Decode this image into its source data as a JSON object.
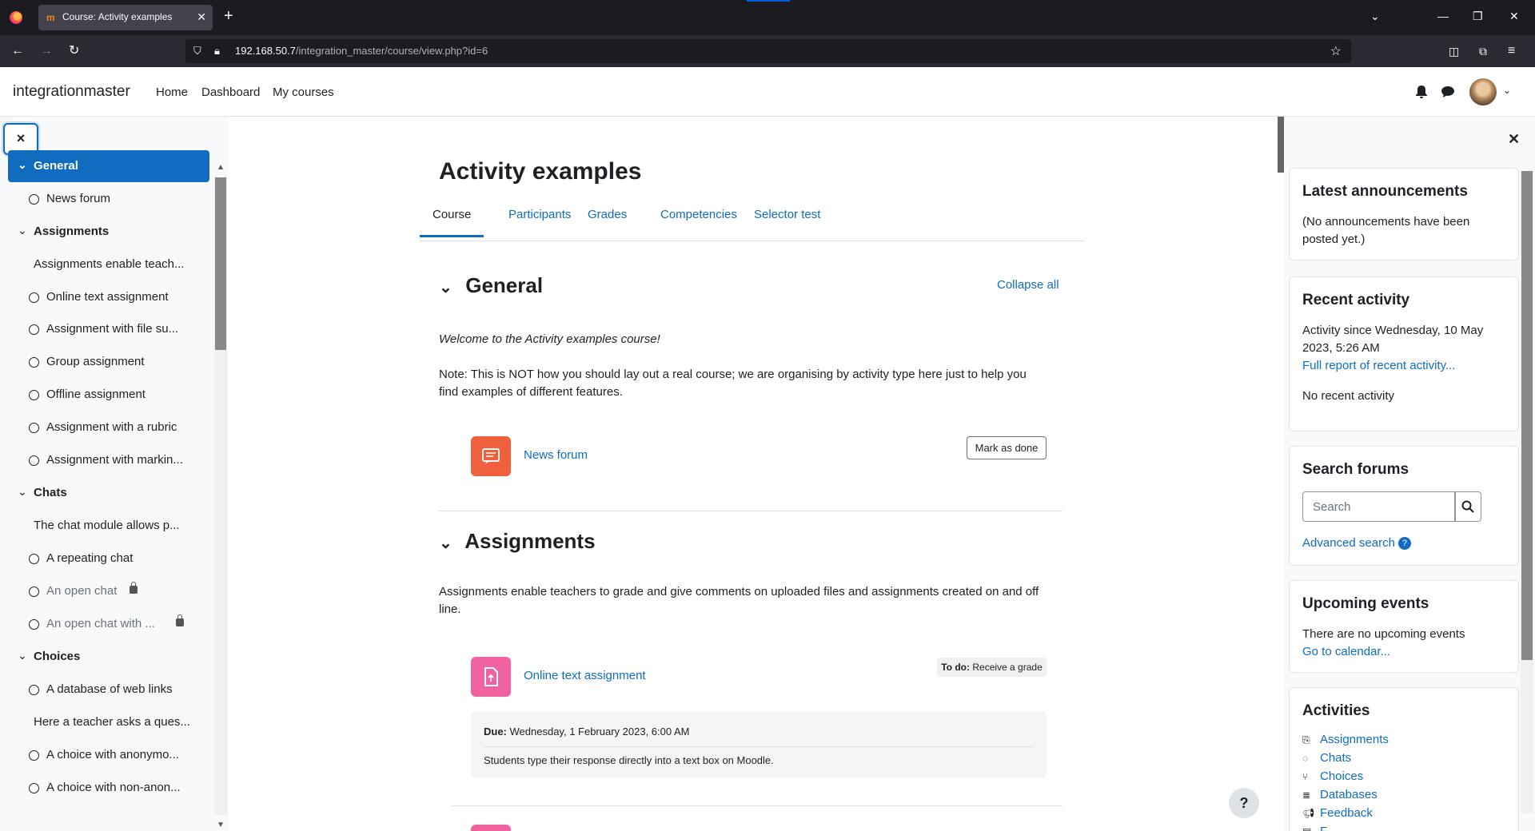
{
  "browser": {
    "tab_title": "Course: Activity examples",
    "tab_favicon": "m",
    "url_host": "192.168.50.7",
    "url_path": "/integration_master/course/view.php?id=6"
  },
  "site": {
    "brand": "integrationmaster",
    "nav": [
      "Home",
      "Dashboard",
      "My courses"
    ]
  },
  "drawer": {
    "close_icon": "×",
    "items": [
      {
        "label": "General",
        "type": "section-active"
      },
      {
        "label": "News forum",
        "type": "activity"
      },
      {
        "label": "Assignments",
        "type": "section"
      },
      {
        "label": "Assignments enable teach...",
        "type": "text"
      },
      {
        "label": "Online text assignment",
        "type": "activity"
      },
      {
        "label": "Assignment with file su...",
        "type": "activity"
      },
      {
        "label": "Group assignment",
        "type": "activity"
      },
      {
        "label": "Offline assignment",
        "type": "activity"
      },
      {
        "label": "Assignment with a rubric",
        "type": "activity"
      },
      {
        "label": "Assignment with markin...",
        "type": "activity"
      },
      {
        "label": "Chats",
        "type": "section"
      },
      {
        "label": "The chat module allows p...",
        "type": "text"
      },
      {
        "label": "A repeating chat",
        "type": "activity"
      },
      {
        "label": "An open chat",
        "type": "activity-locked"
      },
      {
        "label": "An open chat with ...",
        "type": "activity-locked"
      },
      {
        "label": "Choices",
        "type": "section"
      },
      {
        "label": "A database of web links",
        "type": "activity"
      },
      {
        "label": "Here a teacher asks a ques...",
        "type": "text"
      },
      {
        "label": "A choice with anonymo...",
        "type": "activity"
      },
      {
        "label": "A choice with non-anon...",
        "type": "activity"
      }
    ]
  },
  "course": {
    "title": "Activity examples",
    "tabs": [
      "Course",
      "Participants",
      "Grades",
      "Competencies",
      "Selector test"
    ],
    "collapse_all": "Collapse all",
    "general": {
      "heading": "General",
      "welcome": "Welcome to the Activity examples course!",
      "note": "Note: This is NOT how you should lay out a real course; we are organising by activity type here just to help you find examples of different features.",
      "news_forum": "News forum",
      "mark_done": "Mark as done"
    },
    "assignments": {
      "heading": "Assignments",
      "description": "Assignments enable teachers to grade and give comments on uploaded files and assignments created on and off line.",
      "online_text": "Online text assignment",
      "todo_label": "To do:",
      "todo_value": "Receive a grade",
      "due_label": "Due:",
      "due_value": "Wednesday, 1 February 2023, 6:00 AM",
      "due_desc": "Students type their response directly into a text box on Moodle."
    },
    "help": "?"
  },
  "blocks": {
    "announcements": {
      "title": "Latest announcements",
      "text": "(No announcements have been posted yet.)"
    },
    "recent": {
      "title": "Recent activity",
      "since": "Activity since Wednesday, 10 May 2023, 5:26 AM",
      "full_report": "Full report of recent activity...",
      "none": "No recent activity"
    },
    "search": {
      "title": "Search forums",
      "placeholder": "Search",
      "advanced": "Advanced search"
    },
    "upcoming": {
      "title": "Upcoming events",
      "none": "There are no upcoming events",
      "calendar": "Go to calendar..."
    },
    "activities": {
      "title": "Activities",
      "items": [
        "Assignments",
        "Chats",
        "Choices",
        "Databases",
        "Feedback",
        "F..."
      ]
    }
  },
  "colors": {
    "accent": "#0f6cbf",
    "forum_icon": "#f0603c",
    "assign_icon": "#f063a0"
  }
}
